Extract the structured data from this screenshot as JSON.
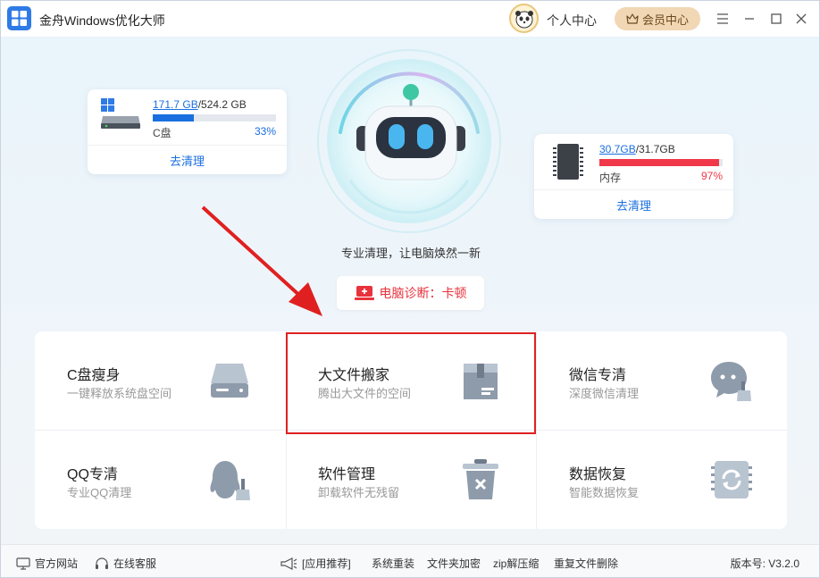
{
  "app": {
    "title": "金舟Windows优化大师"
  },
  "header": {
    "personal_label": "个人中心",
    "vip_label": "会员中心"
  },
  "disk": {
    "used": "171.7 GB",
    "total": "/524.2 GB",
    "name": "C盘",
    "percent": "33%",
    "fill": 33,
    "action": "去清理",
    "color": "#1a6fe0"
  },
  "memory": {
    "used": "30.7GB",
    "total": "/31.7GB",
    "name": "内存",
    "percent": "97%",
    "fill": 97,
    "action": "去清理",
    "color": "#f0384a"
  },
  "center": {
    "slogan": "专业清理，让电脑焕然一新",
    "diagnosis": "电脑诊断：卡顿"
  },
  "tiles": [
    {
      "title": "C盘瘦身",
      "subtitle": "一键释放系统盘空间",
      "icon": "disk-drive-icon"
    },
    {
      "title": "大文件搬家",
      "subtitle": "腾出大文件的空间",
      "icon": "box-icon"
    },
    {
      "title": "微信专清",
      "subtitle": "深度微信清理",
      "icon": "chat-broom-icon"
    },
    {
      "title": "QQ专清",
      "subtitle": "专业QQ清理",
      "icon": "qq-broom-icon"
    },
    {
      "title": "软件管理",
      "subtitle": "卸载软件无残留",
      "icon": "trash-icon"
    },
    {
      "title": "数据恢复",
      "subtitle": "智能数据恢复",
      "icon": "recover-icon"
    }
  ],
  "footer": {
    "website": "官方网站",
    "service": "在线客服",
    "recommend": "[应用推荐]",
    "links": [
      "系统重装",
      "文件夹加密",
      "zip解压缩",
      "重复文件删除"
    ],
    "version": "版本号: V3.2.0"
  }
}
